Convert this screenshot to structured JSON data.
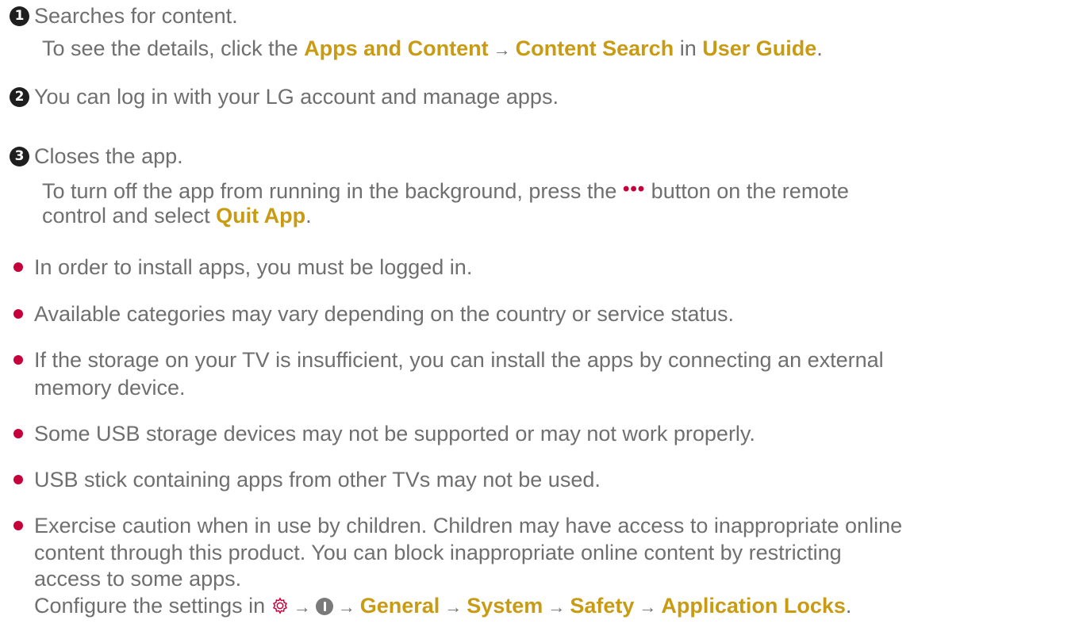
{
  "items": [
    {
      "marker": "1",
      "line1": "Searches for content.",
      "line2_pre": "To see the details, click the ",
      "link1": "Apps and Content",
      "link2": "Content Search",
      "line2_mid": " in ",
      "link3": "User Guide",
      "line2_end": "."
    },
    {
      "marker": "2",
      "line1": "You can log in with your LG account and manage apps."
    },
    {
      "marker": "3",
      "line1": "Closes the app.",
      "line2_pre": "To turn off the app from running in the background, press the ",
      "dots": "•••",
      "line2_post": " button on the remote",
      "line3_pre": "control and select ",
      "link": "Quit App",
      "line3_end": "."
    }
  ],
  "bullets": [
    "In order to install apps, you must be logged in.",
    "Available categories may vary depending on the country or service status.",
    "If the storage on your TV is insufficient, you can install the apps by connecting an external",
    "memory device.",
    "Some USB storage devices may not be supported or may not work properly.",
    "USB stick containing apps from other TVs may not be used.",
    "Exercise caution when in use by children. Children may have access to inappropriate online",
    "content through this product. You can block inappropriate online content by restricting",
    "access to some apps."
  ],
  "configure": {
    "pre": "Configure the settings in ",
    "gear_icon": "gear-icon",
    "more_icon": "more-icon",
    "path": [
      "General",
      "System",
      "Safety",
      "Application Locks"
    ],
    "end": "."
  },
  "arrow": "→",
  "colors": {
    "link": "#c89b13",
    "bullet": "#c5003b",
    "text": "#6f6f6f"
  }
}
